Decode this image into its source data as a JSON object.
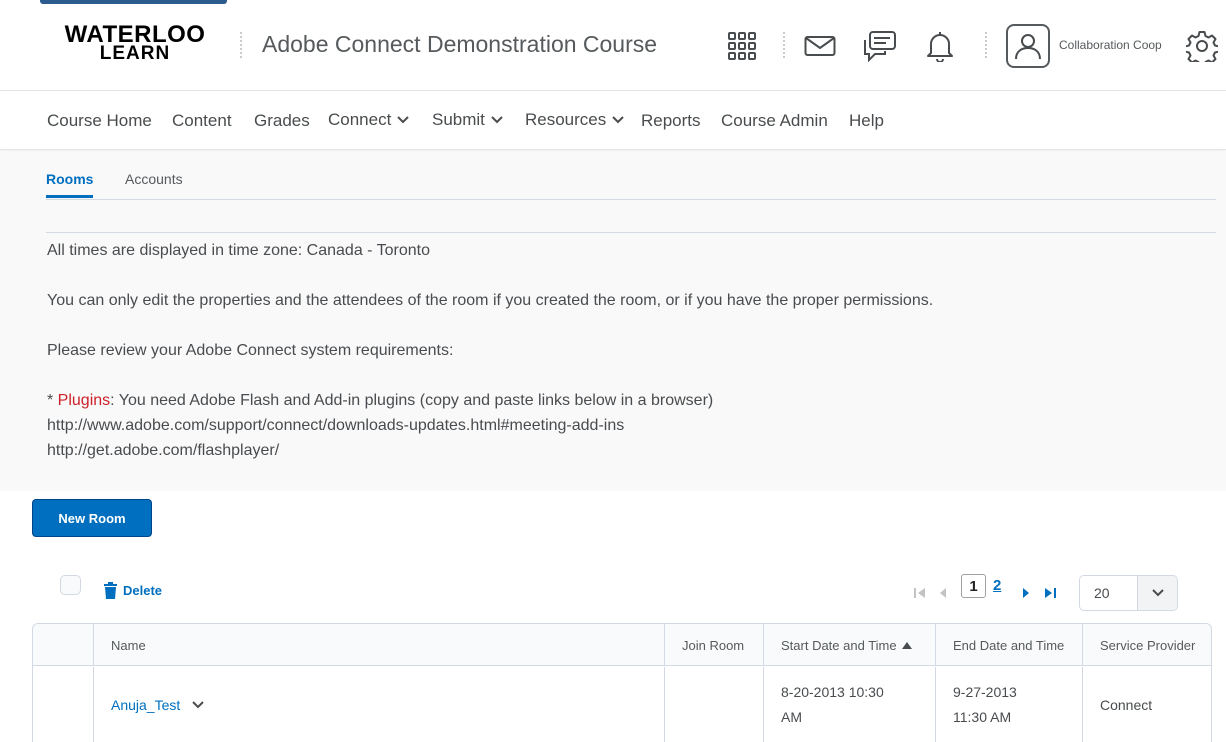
{
  "header": {
    "logo_line1": "WATERLOO",
    "logo_line2": "LEARN",
    "course_title": "Adobe Connect Demonstration Course",
    "user_name": "Collaboration Coop",
    "icons": [
      "grid-icon",
      "mail-icon",
      "chat-icon",
      "bell-icon",
      "user-icon",
      "gear-icon"
    ]
  },
  "nav": {
    "items": [
      {
        "label": "Course Home"
      },
      {
        "label": "Content"
      },
      {
        "label": "Grades"
      },
      {
        "label": "Connect"
      },
      {
        "label": "Submit"
      },
      {
        "label": "Resources"
      },
      {
        "label": "Reports"
      },
      {
        "label": "Course Admin"
      },
      {
        "label": "Help"
      }
    ]
  },
  "tabs": [
    {
      "label": "Rooms",
      "active": true
    },
    {
      "label": "Accounts",
      "active": false
    }
  ],
  "info": {
    "timezone": "All times are displayed in time zone: Canada - Toronto",
    "permissions": "You can only edit the properties and the attendees of the room if you created the room, or if you have the proper permissions.",
    "review": "Please review your Adobe Connect system requirements:",
    "plugins_prefix": "* ",
    "plugins_label": "Plugins",
    "plugins_text": ": You need Adobe Flash and Add-in plugins (copy and paste links below in a browser)",
    "link1": "http://www.adobe.com/support/connect/downloads-updates.html#meeting-add-ins",
    "link2": "http://get.adobe.com/flashplayer/"
  },
  "actions": {
    "new_room": "New Room",
    "delete": "Delete"
  },
  "pagination": {
    "current_page": "1",
    "next_page": "2",
    "page_size": "20"
  },
  "table": {
    "columns": [
      "Name",
      "Join Room",
      "Start Date and Time",
      "End Date and Time",
      "Service Provider"
    ],
    "sorted_column": "Start Date and Time",
    "rows": [
      {
        "name": "Anuja_Test",
        "join_room": "",
        "start_line1": "8-20-2013 10:30",
        "start_line2": "AM",
        "end_line1": "9-27-2013",
        "end_line2": "11:30 AM",
        "provider": "Connect"
      }
    ]
  },
  "colors": {
    "accent": "#006fbf",
    "warning_text": "#cd2026"
  }
}
